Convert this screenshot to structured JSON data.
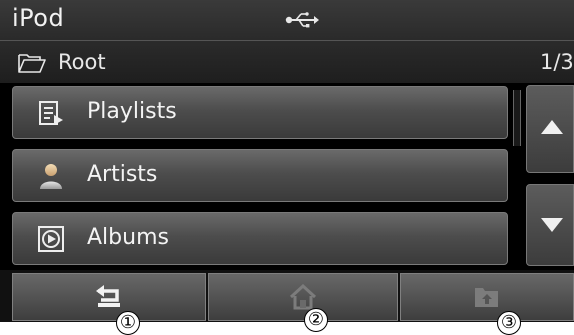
{
  "header": {
    "app_title": "iPod",
    "connection_icon": "usb-icon"
  },
  "path": {
    "folder_icon": "folder-open-icon",
    "label": "Root",
    "page": "1/3"
  },
  "list": {
    "items": [
      {
        "label": "Playlists",
        "icon": "playlist-icon"
      },
      {
        "label": "Artists",
        "icon": "artist-icon"
      },
      {
        "label": "Albums",
        "icon": "album-icon"
      }
    ]
  },
  "scroll": {
    "up_icon": "arrow-up-icon",
    "down_icon": "arrow-down-icon"
  },
  "bottom_bar": {
    "buttons": [
      {
        "icon": "back-icon",
        "enabled": true
      },
      {
        "icon": "home-icon",
        "enabled": false
      },
      {
        "icon": "folder-up-icon",
        "enabled": false
      }
    ]
  },
  "callouts": [
    "①",
    "②",
    "③"
  ]
}
